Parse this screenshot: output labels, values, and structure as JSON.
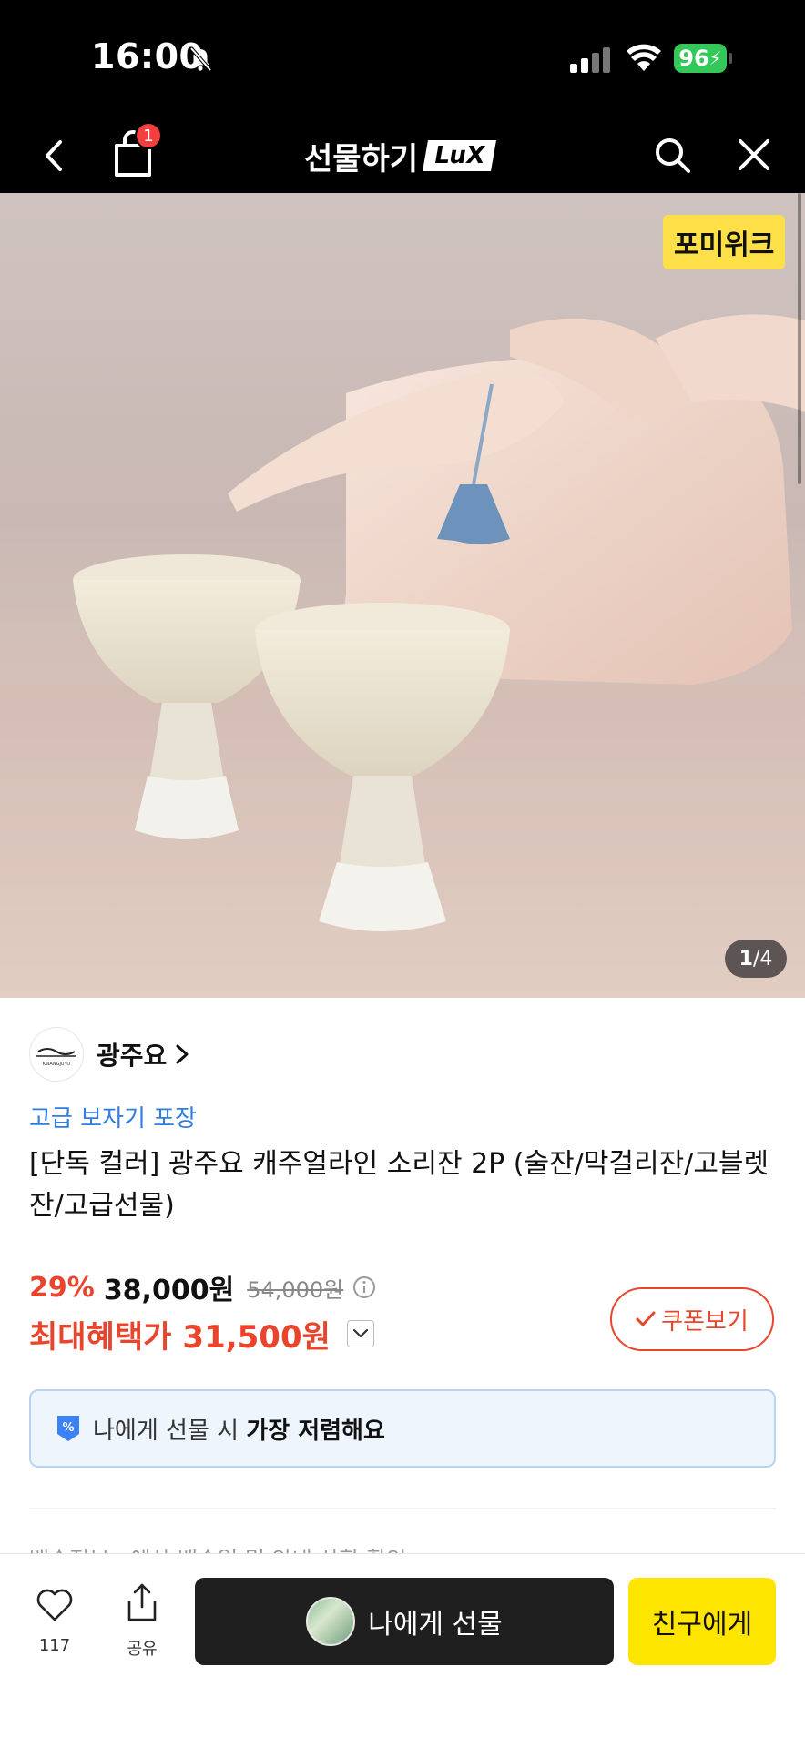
{
  "status_bar": {
    "time": "16:00",
    "battery": "96"
  },
  "nav": {
    "title": "선물하기",
    "badge": "LuX",
    "cart_count": "1"
  },
  "hero": {
    "brand_tag": "포미위크",
    "page_current": "1",
    "page_total": "/4"
  },
  "product": {
    "store_name": "광주요",
    "store_logo_text": "KWANGJUYO",
    "promo_label": "고급 보자기 포장",
    "title": "[단독 컬러] 광주요 캐주얼라인 소리잔 2P (술잔/막걸리잔/고블렛잔/고급선물)",
    "discount": "29%",
    "price": "38,000원",
    "original_price": "54,000원",
    "benefit_label": "최대혜택가",
    "benefit_price": "31,500원",
    "coupon_label": "쿠폰보기",
    "gift_banner_prefix": "나에게 선물 시",
    "gift_banner_bold": "가장 저렴해요",
    "next_section_preview": "배송정보 · 예상 배송일 및 안내 사항 확인"
  },
  "bottom_bar": {
    "like_count": "117",
    "share_label": "공유",
    "self_gift_label": "나에게 선물",
    "friend_gift_label": "친구에게"
  },
  "colors": {
    "accent_red": "#e8452c",
    "link_blue": "#2f7de1",
    "kakao_yellow": "#fee500",
    "badge_red": "#f43f3f"
  }
}
